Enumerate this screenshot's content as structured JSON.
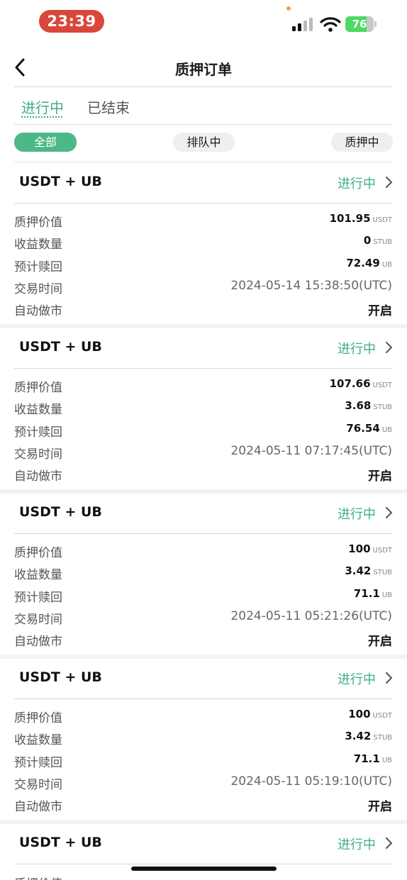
{
  "status_bar": {
    "time": "23:39",
    "battery": "76"
  },
  "header": {
    "title": "质押订单"
  },
  "tabs": [
    {
      "label": "进行中",
      "active": true
    },
    {
      "label": "已结束",
      "active": false
    }
  ],
  "filters": [
    {
      "label": "全部",
      "active": true
    },
    {
      "label": "排队中",
      "active": false
    },
    {
      "label": "质押中",
      "active": false
    }
  ],
  "labels": {
    "value": "质押价值",
    "earnings": "收益数量",
    "redeem": "预计赎回",
    "time": "交易时间",
    "auto": "自动做市"
  },
  "orders": [
    {
      "pair": "USDT + UB",
      "status": "进行中",
      "value": "101.95",
      "value_unit": "USDT",
      "earnings": "0",
      "earnings_unit": "STUB",
      "redeem": "72.49",
      "redeem_unit": "UB",
      "time": "2024-05-14 15:38:50(UTC)",
      "auto": "开启"
    },
    {
      "pair": "USDT + UB",
      "status": "进行中",
      "value": "107.66",
      "value_unit": "USDT",
      "earnings": "3.68",
      "earnings_unit": "STUB",
      "redeem": "76.54",
      "redeem_unit": "UB",
      "time": "2024-05-11 07:17:45(UTC)",
      "auto": "开启"
    },
    {
      "pair": "USDT + UB",
      "status": "进行中",
      "value": "100",
      "value_unit": "USDT",
      "earnings": "3.42",
      "earnings_unit": "STUB",
      "redeem": "71.1",
      "redeem_unit": "UB",
      "time": "2024-05-11 05:21:26(UTC)",
      "auto": "开启"
    },
    {
      "pair": "USDT + UB",
      "status": "进行中",
      "value": "100",
      "value_unit": "USDT",
      "earnings": "3.42",
      "earnings_unit": "STUB",
      "redeem": "71.1",
      "redeem_unit": "UB",
      "time": "2024-05-11 05:19:10(UTC)",
      "auto": "开启"
    },
    {
      "pair": "USDT + UB",
      "status": "进行中"
    }
  ],
  "colors": {
    "accent": "#3fae8a",
    "filter_active": "#4cb888",
    "time_pill": "#d9463b"
  },
  "icons": {
    "back": "chevron-left-icon",
    "row_arrow": "chevron-right-icon"
  }
}
